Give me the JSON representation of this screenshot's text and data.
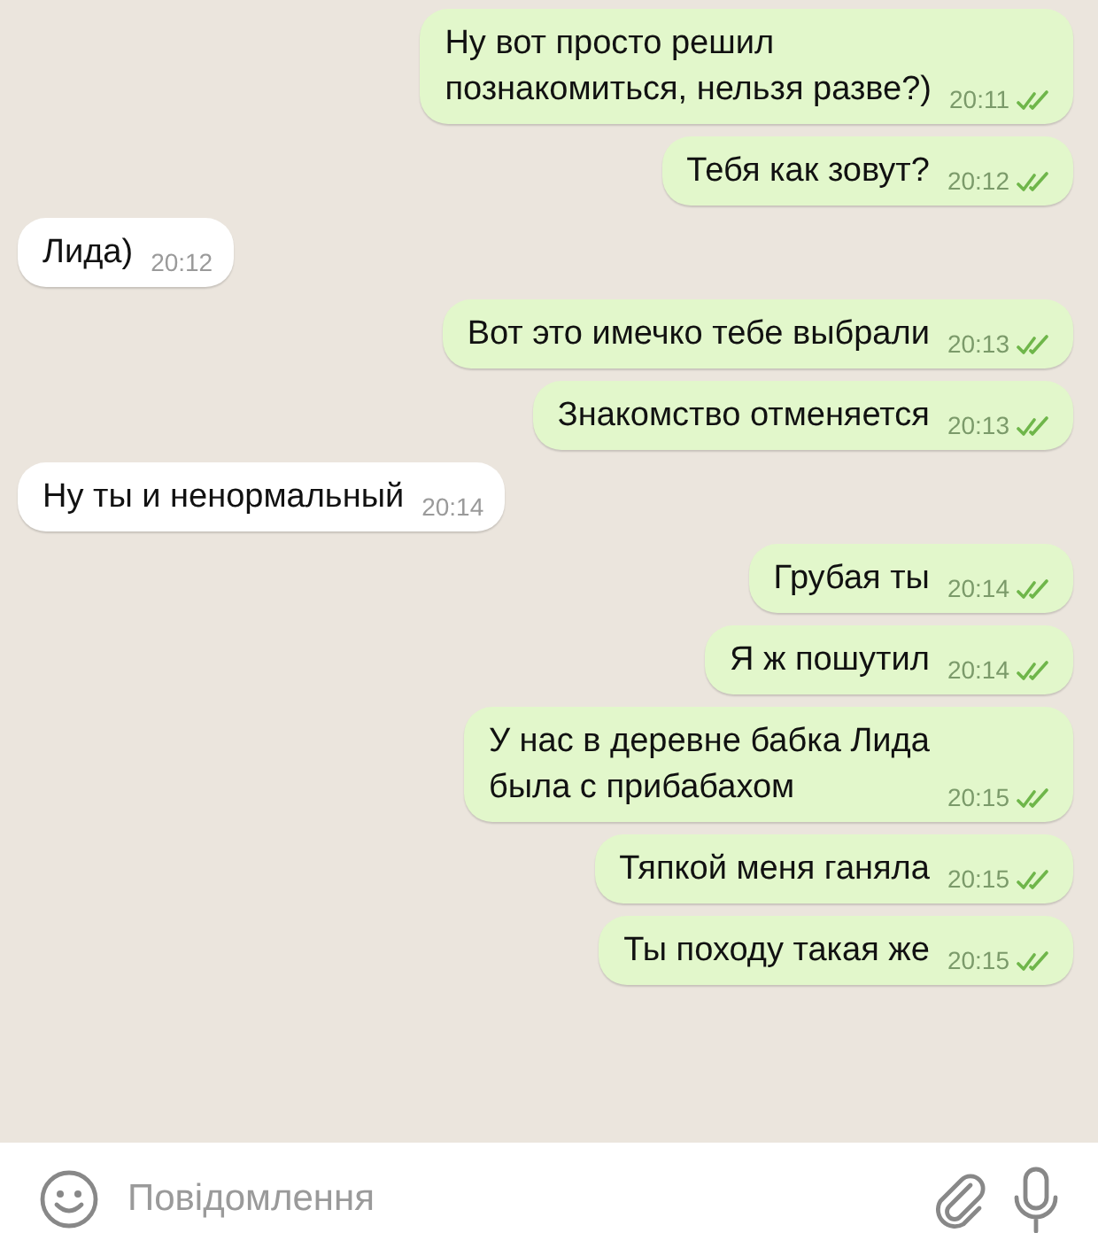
{
  "messages": [
    {
      "kind": "out",
      "lines": [
        "Ну вот просто решил",
        "познакомиться, нельзя разве?)"
      ],
      "time": "20:11",
      "read": true
    },
    {
      "kind": "out",
      "lines": [
        "Тебя как зовут?"
      ],
      "time": "20:12",
      "read": true
    },
    {
      "kind": "in",
      "lines": [
        "Лида)"
      ],
      "time": "20:12"
    },
    {
      "kind": "out",
      "lines": [
        "Вот это имечко тебе выбрали"
      ],
      "time": "20:13",
      "read": true
    },
    {
      "kind": "out",
      "lines": [
        "Знакомство отменяется"
      ],
      "time": "20:13",
      "read": true
    },
    {
      "kind": "in",
      "lines": [
        "Ну ты и ненормальный"
      ],
      "time": "20:14"
    },
    {
      "kind": "out",
      "lines": [
        "Грубая ты"
      ],
      "time": "20:14",
      "read": true
    },
    {
      "kind": "out",
      "lines": [
        "Я ж пошутил"
      ],
      "time": "20:14",
      "read": true
    },
    {
      "kind": "out",
      "lines": [
        "У нас в деревне бабка Лида",
        "была с прибабахом"
      ],
      "time": "20:15",
      "read": true
    },
    {
      "kind": "out",
      "lines": [
        "Тяпкой меня ганяла"
      ],
      "time": "20:15",
      "read": true
    },
    {
      "kind": "out",
      "lines": [
        "Ты походу такая же"
      ],
      "time": "20:15",
      "read": true
    }
  ],
  "composer": {
    "placeholder": "Повідомлення"
  }
}
